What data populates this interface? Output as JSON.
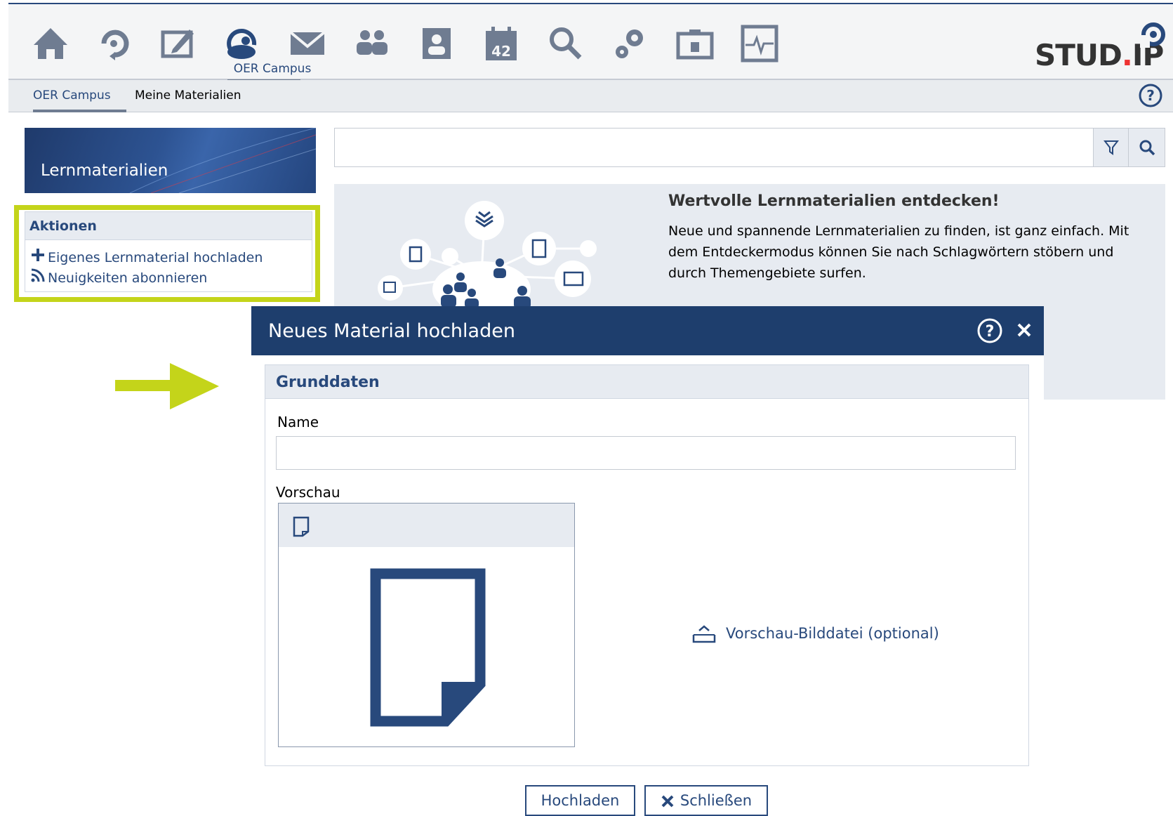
{
  "header": {
    "nav_icons": [
      "home-icon",
      "activity-icon",
      "edit-icon",
      "oer-campus-icon",
      "mail-icon",
      "community-icon",
      "profile-icon",
      "calendar-icon",
      "search-icon",
      "admin-icon",
      "resources-icon",
      "monitor-icon"
    ],
    "calendar_day": "42",
    "active_label": "OER Campus",
    "logo_text_main": "STUD",
    "logo_text_dot": ".",
    "logo_text_end": "IP"
  },
  "subnav": {
    "items": [
      "OER Campus",
      "Meine Materialien"
    ]
  },
  "sidebar": {
    "title": "Lernmaterialien",
    "actions_title": "Aktionen",
    "actions": [
      "Eigenes Lernmaterial hochladen",
      "Neuigkeiten abonnieren"
    ]
  },
  "search": {
    "value": ""
  },
  "info": {
    "title": "Wertvolle Lernmaterialien entdecken!",
    "text": "Neue und spannende Lernmaterialien zu finden, ist ganz einfach. Mit dem Entdeckermodus können Sie nach Schlagwörtern stöbern und durch Themengebiete surfen."
  },
  "dialog": {
    "title": "Neues Material hochladen",
    "section": "Grunddaten",
    "name_label": "Name",
    "name_value": "",
    "preview_label": "Vorschau",
    "preview_upload": "Vorschau-Bilddatei (optional)",
    "buttons": {
      "upload": "Hochladen",
      "close": "Schließen"
    }
  },
  "colors": {
    "brand": "#28497c",
    "dialog_header": "#1e3e6d",
    "highlight": "#c4d41a",
    "panel": "#e7ebf1"
  }
}
